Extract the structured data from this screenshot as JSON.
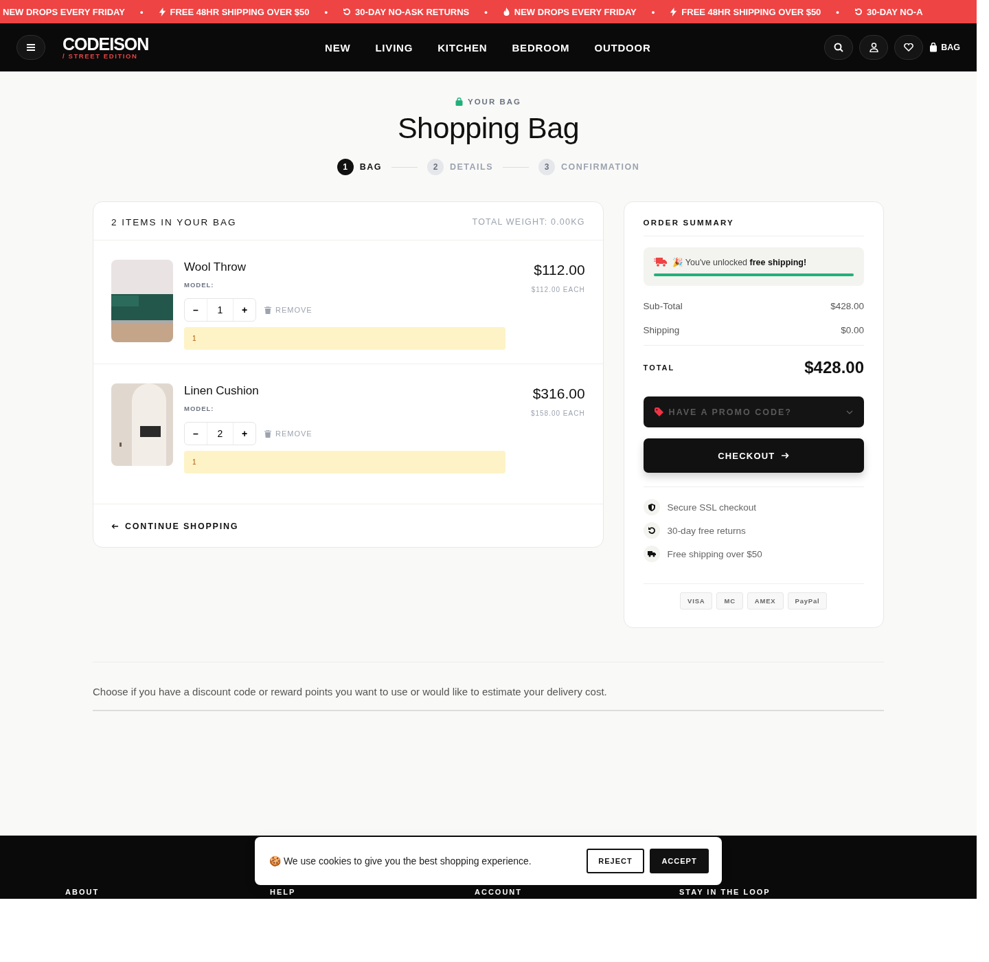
{
  "announcement_bar": {
    "items": [
      {
        "kind": "none",
        "text": "NEW DROPS EVERY FRIDAY"
      },
      {
        "kind": "bolt",
        "text": "FREE 48HR SHIPPING OVER $50"
      },
      {
        "kind": "return",
        "text": "30-DAY NO-ASK RETURNS"
      },
      {
        "kind": "flame",
        "text": "NEW DROPS EVERY FRIDAY"
      },
      {
        "kind": "bolt",
        "text": "FREE 48HR SHIPPING OVER $50"
      },
      {
        "kind": "return",
        "text": "30-DAY NO-A"
      }
    ],
    "separator": "•"
  },
  "header": {
    "logo": "CODEISON",
    "tagline": "/ STREET EDITION",
    "nav": [
      "NEW",
      "LIVING",
      "KITCHEN",
      "BEDROOM",
      "OUTDOOR"
    ],
    "bag_label": "BAG"
  },
  "page_header": {
    "eyebrow": "YOUR BAG",
    "title": "Shopping Bag"
  },
  "steps": [
    {
      "number": "1",
      "label": "BAG",
      "selected": true
    },
    {
      "number": "2",
      "label": "DETAILS",
      "selected": false
    },
    {
      "number": "3",
      "label": "CONFIRMATION",
      "selected": false
    }
  ],
  "cart": {
    "title": "2 ITEMS IN YOUR BAG",
    "weight": "TOTAL WEIGHT: 0.00KG",
    "items": [
      {
        "kind": "sofa",
        "name": "Wool Throw",
        "model_label": "MODEL:",
        "quantity": "1",
        "remove": "REMOVE",
        "note": "1",
        "price": "$112.00",
        "each": "$112.00 EACH"
      },
      {
        "kind": "interior",
        "name": "Linen Cushion",
        "model_label": "MODEL:",
        "quantity": "2",
        "remove": "REMOVE",
        "note": "1",
        "price": "$316.00",
        "each": "$158.00 EACH"
      }
    ],
    "minus": "–",
    "plus": "+",
    "continue": "CONTINUE SHOPPING"
  },
  "summary": {
    "title": "ORDER SUMMARY",
    "shipping_notice": "🎉 You've unlocked **free shipping!**",
    "shipping_progress": {
      "level": 1.0
    },
    "lines": [
      {
        "label": "Sub-Total",
        "value": "$428.00"
      },
      {
        "label": "Shipping",
        "value": "$0.00"
      }
    ],
    "total_label": "TOTAL",
    "total": "$428.00",
    "promo": "HAVE A PROMO CODE?",
    "checkout": "CHECKOUT",
    "assurances": [
      {
        "kind": "shield",
        "text": "Secure SSL checkout"
      },
      {
        "kind": "return",
        "text": "30-day free returns"
      },
      {
        "kind": "truck",
        "text": "Free shipping over $50"
      }
    ],
    "payment_methods": [
      "VISA",
      "MC",
      "AMEX",
      "PayPal"
    ]
  },
  "info_text": "Choose if you have a discount code or reward points you want to use or would like to estimate your delivery cost.",
  "cookie_banner": {
    "icon": "🍪",
    "text": "We use cookies to give you the best shopping experience.",
    "reject": "REJECT",
    "accept": "ACCEPT"
  },
  "footer": {
    "headings": [
      "ABOUT",
      "HELP",
      "ACCOUNT",
      "STAY IN THE LOOP"
    ]
  }
}
